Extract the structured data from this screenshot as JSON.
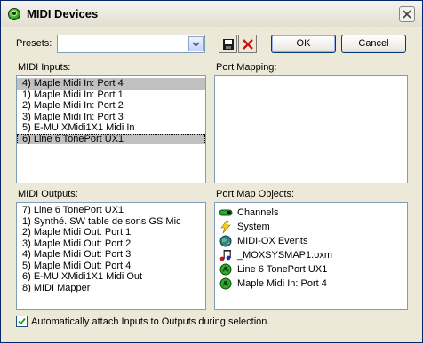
{
  "window": {
    "title": "MIDI Devices"
  },
  "presets": {
    "label": "Presets:",
    "value": ""
  },
  "buttons": {
    "ok": "OK",
    "cancel": "Cancel"
  },
  "midi_inputs": {
    "label": "MIDI Inputs:",
    "items": [
      "4)  Maple Midi In: Port 4",
      "1)  Maple Midi In: Port 1",
      "2)  Maple Midi In: Port 2",
      "3)  Maple Midi In: Port 3",
      "5)  E-MU XMidi1X1  Midi In",
      "6)  Line 6 TonePort UX1"
    ],
    "selected": [
      0,
      5
    ]
  },
  "port_mapping": {
    "label": "Port Mapping:"
  },
  "midi_outputs": {
    "label": "MIDI Outputs:",
    "items": [
      "7)  Line 6 TonePort UX1",
      "1)  Synthé. SW table de sons GS Mic",
      "2)  Maple Midi Out: Port 1",
      "3)  Maple Midi Out: Port 2",
      "4)  Maple Midi Out: Port 3",
      "5)  Maple Midi Out: Port 4",
      "6)  E-MU XMidi1X1 Midi Out",
      "8)  MIDI Mapper"
    ]
  },
  "port_map_objects": {
    "label": "Port Map Objects:",
    "items": [
      {
        "label": "Channels",
        "icon": "channels-icon"
      },
      {
        "label": "System",
        "icon": "lightning-icon"
      },
      {
        "label": "MIDI-OX Events",
        "icon": "globe-icon"
      },
      {
        "label": "_MOXSYSMAP1.oxm",
        "icon": "music-notes-icon"
      },
      {
        "label": "Line 6 TonePort UX1",
        "icon": "port-icon"
      },
      {
        "label": "Maple Midi In: Port 4",
        "icon": "port-icon"
      }
    ]
  },
  "auto_attach": {
    "label": "Automatically attach Inputs to Outputs during selection.",
    "checked": true
  },
  "colors": {
    "selection": "#c0c0c0",
    "border": "#7f9db9",
    "face": "#ece9d8"
  }
}
